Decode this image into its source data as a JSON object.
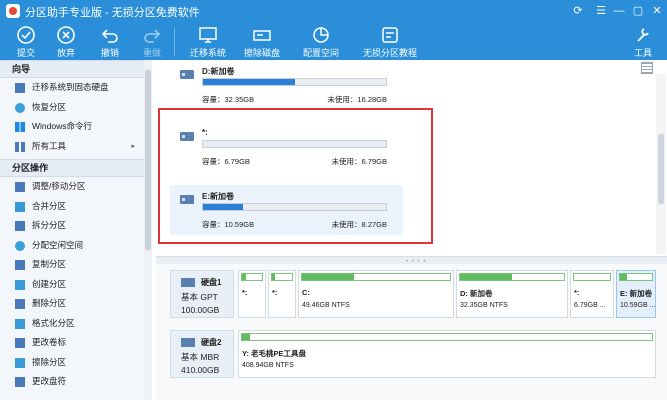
{
  "window": {
    "title": "分区助手专业版 - 无损分区免费软件",
    "controls": [
      "⟳",
      "☰",
      "—",
      "▢",
      "✕"
    ]
  },
  "toolbar": {
    "buttons": [
      {
        "label": "提交",
        "icon": "check-icon",
        "disabled": false
      },
      {
        "label": "放弃",
        "icon": "cancel-icon",
        "disabled": false
      },
      {
        "label": "撤销",
        "icon": "undo-icon",
        "disabled": false
      },
      {
        "label": "重做",
        "icon": "redo-icon",
        "disabled": true
      },
      {
        "label": "迁移系统",
        "icon": "migrate-os-icon",
        "disabled": false
      },
      {
        "label": "擦除磁盘",
        "icon": "wipe-disk-icon",
        "disabled": false
      },
      {
        "label": "配置空间",
        "icon": "allocate-space-icon",
        "disabled": false
      },
      {
        "label": "无损分区教程",
        "icon": "tutorial-icon",
        "disabled": false
      },
      {
        "label": "工具",
        "icon": "tools-icon",
        "disabled": false
      }
    ]
  },
  "sidebar": {
    "wizard_title": "向导",
    "wizard_items": [
      {
        "label": "迁移系统到固态硬盘",
        "icon": "migrate-ssd-icon"
      },
      {
        "label": "恢复分区",
        "icon": "restore-icon"
      },
      {
        "label": "Windows命令行",
        "icon": "windows-icon"
      },
      {
        "label": "所有工具",
        "icon": "grid-icon",
        "arrow": "▸"
      }
    ],
    "ops_title": "分区操作",
    "ops_items": [
      {
        "label": "调整/移动分区",
        "icon": "resize-icon"
      },
      {
        "label": "合并分区",
        "icon": "merge-icon"
      },
      {
        "label": "拆分分区",
        "icon": "split-icon"
      },
      {
        "label": "分配空闲空间",
        "icon": "allocate-icon"
      },
      {
        "label": "复制分区",
        "icon": "copy-icon"
      },
      {
        "label": "创建分区",
        "icon": "create-icon"
      },
      {
        "label": "删除分区",
        "icon": "delete-icon"
      },
      {
        "label": "格式化分区",
        "icon": "format-icon"
      },
      {
        "label": "更改卷标",
        "icon": "label-icon"
      },
      {
        "label": "擦除分区",
        "icon": "wipe-icon"
      },
      {
        "label": "更改盘符",
        "icon": "drive-letter-icon"
      }
    ]
  },
  "partitions": [
    {
      "name": "D:新加卷",
      "capacity": "容量：32.35GB",
      "free": "未使用：16.28GB",
      "used_fraction": 0.5,
      "selected": false
    },
    {
      "name": "*:",
      "capacity": "容量：6.79GB",
      "free": "未使用：6.79GB",
      "used_fraction": 0.0,
      "selected": false
    },
    {
      "name": "E:新加卷",
      "capacity": "容量：10.59GB",
      "free": "未使用：8.27GB",
      "used_fraction": 0.22,
      "selected": true
    }
  ],
  "disks": [
    {
      "name": "硬盘1",
      "type": "基本 GPT",
      "size": "100.00GB",
      "parts": [
        {
          "label": "*:",
          "size": "",
          "used_fraction": 0.2,
          "selected": false
        },
        {
          "label": "*:",
          "size": "",
          "used_fraction": 0.15,
          "selected": false
        },
        {
          "label": "C:",
          "size": "49.46GB NTFS",
          "used_fraction": 0.7,
          "selected": false
        },
        {
          "label": "D: 新加卷",
          "size": "32.35GB NTFS",
          "used_fraction": 0.5,
          "selected": false
        },
        {
          "label": "*:",
          "size": "6.79GB ...",
          "used_fraction": 0.0,
          "selected": false
        },
        {
          "label": "E: 新加卷",
          "size": "10.59GB ...",
          "used_fraction": 0.22,
          "selected": true
        }
      ]
    },
    {
      "name": "硬盘2",
      "type": "基本 MBR",
      "size": "410.00GB",
      "parts": [
        {
          "label": "Y: 老毛桃PE工具盘",
          "size": "408.94GB NTFS",
          "used_fraction": 0.02,
          "selected": false
        }
      ]
    }
  ],
  "colors": {
    "titlebar": "#2a8fd8",
    "highlight_box": "#d9333d",
    "partition_fill": "#2b7fd8",
    "disk_fill": "#5fbd5f"
  }
}
